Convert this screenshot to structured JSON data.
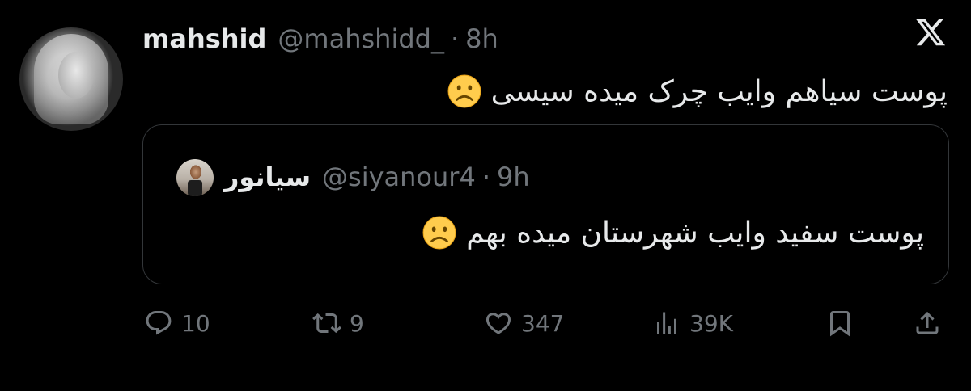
{
  "author": {
    "display_name": "mahshid",
    "handle": "@mahshidd_",
    "separator": "·",
    "time": "8h"
  },
  "tweet": {
    "text": "پوست سیاهم وایب چرک میده سیسی",
    "emoji": "frowning-face-emoji"
  },
  "quoted": {
    "display_name": "سیانور",
    "handle": "@siyanour4",
    "separator": "·",
    "time": "9h",
    "text": "پوست سفید وایب شهرستان میده بهم",
    "emoji": "frowning-face-emoji"
  },
  "actions": {
    "replies": "10",
    "reposts": "9",
    "likes": "347",
    "views": "39K"
  },
  "icons": {
    "logo": "x-logo-icon",
    "reply": "reply-icon",
    "repost": "repost-icon",
    "like": "heart-icon",
    "views": "views-icon",
    "bookmark": "bookmark-icon",
    "share": "share-icon"
  },
  "colors": {
    "background": "#000000",
    "text": "#e7e9ea",
    "muted": "#71767b",
    "border": "#333639"
  }
}
